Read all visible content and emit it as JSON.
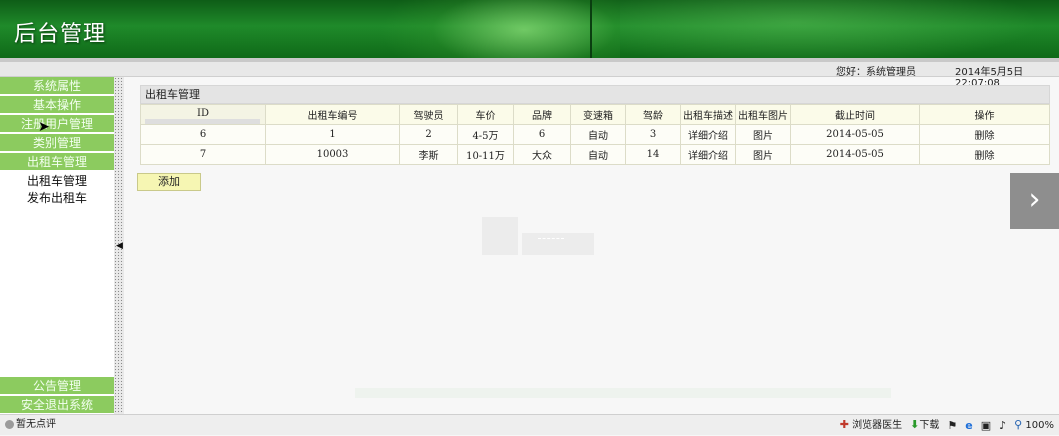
{
  "header": {
    "title": "后台管理"
  },
  "infobar": {
    "greeting": "您好：系统管理员",
    "datetime": "2014年5月5日  22:07:08"
  },
  "sidebar": {
    "items": [
      {
        "label": "系统属性"
      },
      {
        "label": "基本操作"
      },
      {
        "label": "注册用户管理"
      },
      {
        "label": "类别管理"
      },
      {
        "label": "出租车管理"
      }
    ],
    "sub_items": [
      {
        "label": "出租车管理"
      },
      {
        "label": "发布出租车"
      }
    ],
    "bottom_items": [
      {
        "label": "公告管理"
      },
      {
        "label": "安全退出系统"
      }
    ]
  },
  "panel": {
    "title": "出租车管理",
    "columns": [
      "ID",
      "出租车编号",
      "驾驶员",
      "车价",
      "品牌",
      "变速箱",
      "驾龄",
      "出租车描述",
      "出租车图片",
      "截止时间",
      "操作"
    ],
    "rows": [
      [
        "6",
        "1",
        "2",
        "4-5万",
        "6",
        "自动",
        "3",
        "详细介绍",
        "图片",
        "2014-05-05",
        "删除"
      ],
      [
        "7",
        "10003",
        "李斯",
        "10-11万",
        "大众",
        "自动",
        "14",
        "详细介绍",
        "图片",
        "2014-05-05",
        "删除"
      ]
    ]
  },
  "buttons": {
    "add": "添加",
    "next": "›"
  },
  "statusbar": {
    "rating": "暂无点评",
    "doctor": "浏览器医生",
    "download": "下载",
    "zoom": "100%"
  }
}
